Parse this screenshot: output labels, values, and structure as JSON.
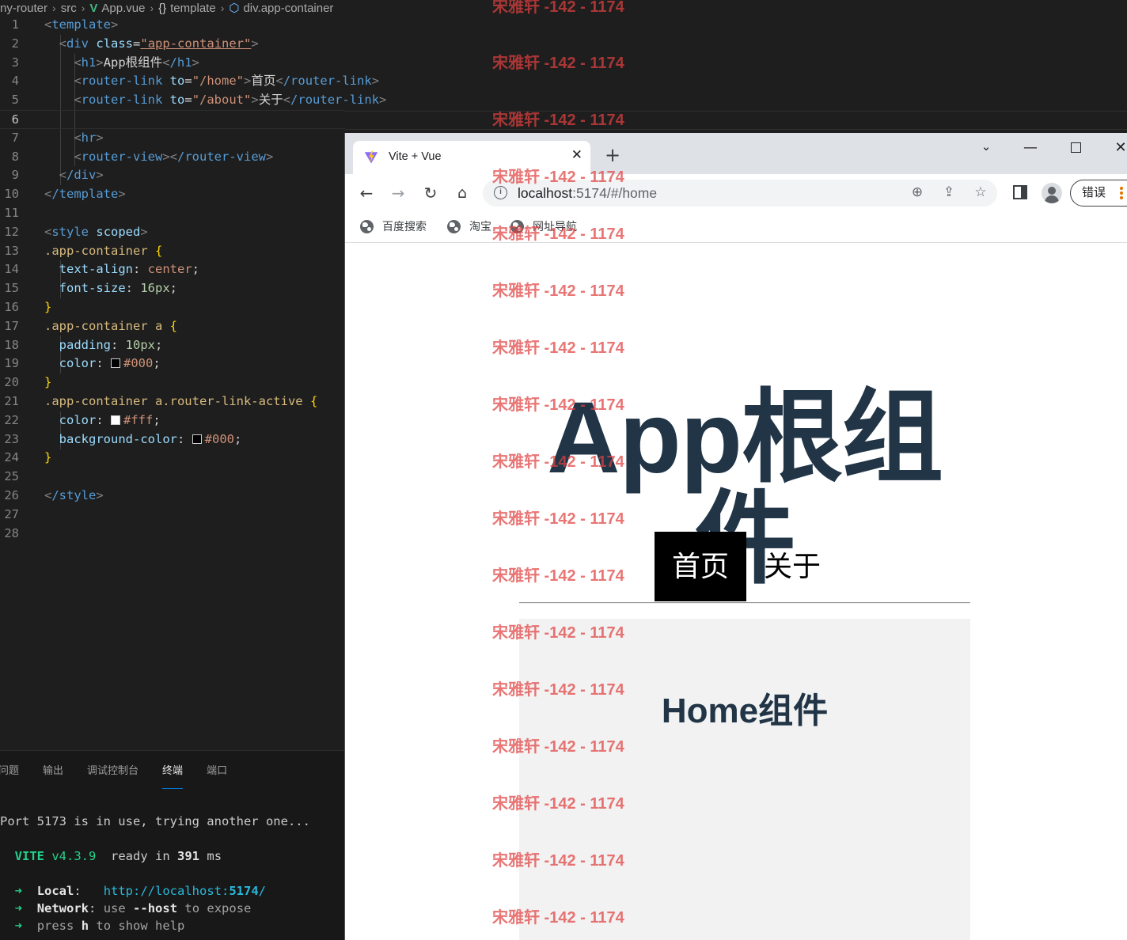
{
  "editor": {
    "breadcrumb": [
      "ny-router",
      "src",
      "App.vue",
      "template",
      "div.app-container"
    ],
    "code_lines": [
      {
        "n": "1"
      },
      {
        "n": "2"
      },
      {
        "n": "3"
      },
      {
        "n": "4"
      },
      {
        "n": "5"
      },
      {
        "n": "6"
      },
      {
        "n": "7"
      },
      {
        "n": "8"
      },
      {
        "n": "9"
      },
      {
        "n": "10"
      },
      {
        "n": "11"
      },
      {
        "n": "12"
      },
      {
        "n": "13"
      },
      {
        "n": "14"
      },
      {
        "n": "15"
      },
      {
        "n": "16"
      },
      {
        "n": "17"
      },
      {
        "n": "18"
      },
      {
        "n": "19"
      },
      {
        "n": "20"
      },
      {
        "n": "21"
      },
      {
        "n": "22"
      },
      {
        "n": "23"
      },
      {
        "n": "24"
      },
      {
        "n": "25"
      },
      {
        "n": "26"
      },
      {
        "n": "27"
      },
      {
        "n": "28"
      }
    ],
    "code": {
      "l1": "template",
      "l2_tag": "div",
      "l2_attr": "class",
      "l2_val": "\"app-container\"",
      "l3_tag": "h1",
      "l3_text": "App根组件",
      "l3_close": "/h1",
      "l4_tag": "router-link",
      "l4_attr": "to",
      "l4_val": "\"/home\"",
      "l4_text": "首页",
      "l4_close": "/router-link",
      "l5_tag": "router-link",
      "l5_attr": "to",
      "l5_val": "\"/about\"",
      "l5_text": "关于",
      "l5_close": "/router-link",
      "l7_tag": "hr",
      "l8_tag": "router-view",
      "l8_close": "/router-view",
      "l9_close": "/div",
      "l10_close": "/template",
      "l12_tag": "style",
      "l12_attr": "scoped",
      "l13_sel": ".app-container",
      "l14_prop": "text-align",
      "l14_val": "center",
      "l15_prop": "font-size",
      "l15_val": "16px",
      "l17_sel": ".app-container a",
      "l18_prop": "padding",
      "l18_val": "10px",
      "l19_prop": "color",
      "l19_val": "#000",
      "l21_sel": ".app-container a.router-link-active",
      "l22_prop": "color",
      "l22_val": "#fff",
      "l23_prop": "background-color",
      "l23_val": "#000",
      "l26_close": "/style"
    }
  },
  "panel": {
    "tabs": [
      "问题",
      "输出",
      "调试控制台",
      "终端",
      "端口"
    ],
    "active_tab": "终端",
    "terminal": {
      "line1": "Port 5173 is in use, trying another one...",
      "vite": "VITE",
      "vite_version": "v4.3.9",
      "ready": "ready in",
      "ready_ms": "391",
      "ms": "ms",
      "arrow": "➜",
      "local_label": "Local",
      "local_url_prefix": "http://localhost:",
      "local_port": "5174",
      "local_url_suffix": "/",
      "network_label": "Network",
      "network_text_a": "use",
      "network_flag": "--host",
      "network_text_b": "to expose",
      "help_a": "press",
      "help_key": "h",
      "help_b": "to show help"
    }
  },
  "browser": {
    "tab_title": "Vite + Vue",
    "url_host": "localhost",
    "url_rest": ":5174/#/home",
    "error_label": "错误",
    "bookmarks": [
      "百度搜索",
      "淘宝",
      "网址导航"
    ],
    "page": {
      "h1": "App根组件",
      "links": [
        {
          "label": "首页",
          "active": true
        },
        {
          "label": "关于",
          "active": false
        }
      ],
      "home_title": "Home组件"
    }
  },
  "watermark": {
    "text": "宋雅轩 -142 - 1174"
  },
  "colors": {
    "editor_bg": "#1e1e1e",
    "heading": "#213547",
    "active_link_bg": "#000000",
    "active_link_text": "#ffffff",
    "watermark": "#e04040"
  }
}
